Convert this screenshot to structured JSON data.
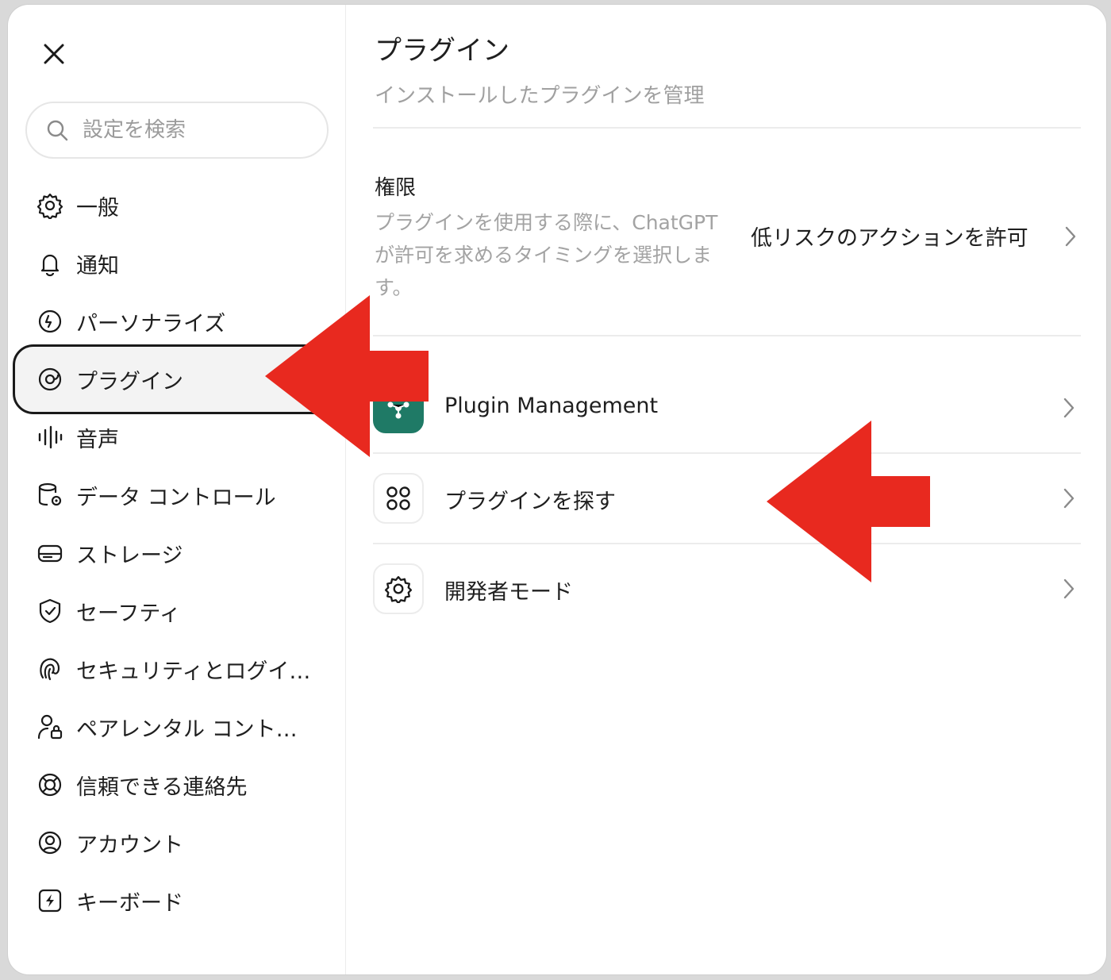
{
  "sidebar": {
    "search_placeholder": "設定を検索",
    "items": [
      {
        "label": "一般",
        "icon": "gear-icon"
      },
      {
        "label": "通知",
        "icon": "bell-icon"
      },
      {
        "label": "パーソナライズ",
        "icon": "personalize-icon"
      },
      {
        "label": "プラグイン",
        "icon": "plugin-icon",
        "active": true
      },
      {
        "label": "音声",
        "icon": "waveform-icon"
      },
      {
        "label": "データ コントロール",
        "icon": "database-gear-icon"
      },
      {
        "label": "ストレージ",
        "icon": "storage-icon"
      },
      {
        "label": "セーフティ",
        "icon": "shield-check-icon"
      },
      {
        "label": "セキュリティとログイ…",
        "icon": "fingerprint-icon"
      },
      {
        "label": "ペアレンタル コント…",
        "icon": "parental-lock-icon"
      },
      {
        "label": "信頼できる連絡先",
        "icon": "lifebuoy-icon"
      },
      {
        "label": "アカウント",
        "icon": "account-icon"
      },
      {
        "label": "キーボード",
        "icon": "keyboard-bolt-icon"
      }
    ]
  },
  "main": {
    "title": "プラグイン",
    "subtitle": "インストールしたプラグインを管理",
    "permissions": {
      "title": "権限",
      "description": "プラグインを使用する際に、ChatGPT が許可を求めるタイミングを選択します。",
      "value": "低リスクのアクションを許可"
    },
    "rows": [
      {
        "label": "Plugin Management",
        "icon": "plugin-management-icon"
      },
      {
        "label": "プラグインを探す",
        "icon": "grid-circles-icon"
      },
      {
        "label": "開発者モード",
        "icon": "gear-icon"
      }
    ]
  },
  "colors": {
    "annotation_arrow": "#e8291f",
    "plugin_tile": "#1f7a66",
    "active_border": "#1a1a1a"
  }
}
